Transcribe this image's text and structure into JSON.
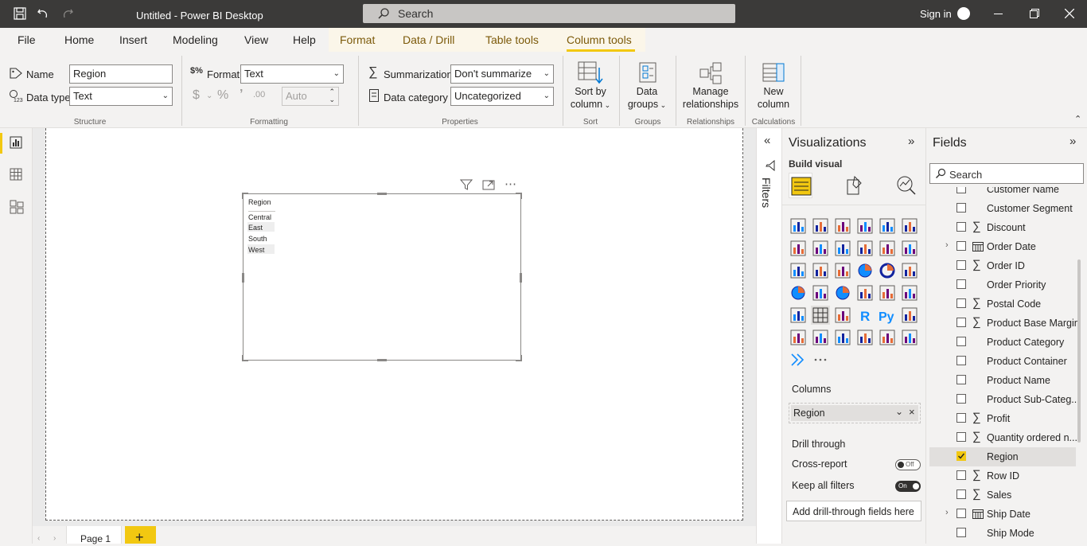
{
  "titlebar": {
    "title": "Untitled - Power BI Desktop",
    "search_placeholder": "Search",
    "sign_in": "Sign in"
  },
  "menu": {
    "items": [
      "File",
      "Home",
      "Insert",
      "Modeling",
      "View",
      "Help",
      "Format",
      "Data / Drill",
      "Table tools",
      "Column tools"
    ]
  },
  "ribbon": {
    "structure": {
      "name_label": "Name",
      "name_value": "Region",
      "datatype_label": "Data type",
      "datatype_value": "Text",
      "group": "Structure"
    },
    "formatting": {
      "format_label": "Format",
      "format_value": "Text",
      "auto_value": "Auto",
      "group": "Formatting"
    },
    "properties": {
      "summarization_label": "Summarization",
      "summarization_value": "Don't summarize",
      "category_label": "Data category",
      "category_value": "Uncategorized",
      "group": "Properties"
    },
    "sort": {
      "line1": "Sort by",
      "line2": "column",
      "group": "Sort"
    },
    "groups": {
      "line1": "Data",
      "line2": "groups",
      "group": "Groups"
    },
    "relationships": {
      "line1": "Manage",
      "line2": "relationships",
      "group": "Relationships"
    },
    "calculations": {
      "line1": "New",
      "line2": "column",
      "group": "Calculations"
    }
  },
  "visual": {
    "header": "Region",
    "rows": [
      "Central",
      "East",
      "South",
      "West"
    ]
  },
  "filters": {
    "label": "Filters"
  },
  "visualizations": {
    "title": "Visualizations",
    "build_visual": "Build visual",
    "columns_label": "Columns",
    "columns_field": "Region",
    "drill_through": "Drill through",
    "cross_report": "Cross-report",
    "cross_report_state": "Off",
    "keep_filters": "Keep all filters",
    "keep_filters_state": "On",
    "add_drill": "Add drill-through fields here"
  },
  "fields": {
    "title": "Fields",
    "search_placeholder": "Search",
    "items": [
      {
        "label": "Customer Name",
        "sigma": false,
        "expand": false,
        "checked": false
      },
      {
        "label": "Customer Segment",
        "sigma": false,
        "expand": false,
        "checked": false
      },
      {
        "label": "Discount",
        "sigma": true,
        "expand": false,
        "checked": false
      },
      {
        "label": "Order Date",
        "sigma": false,
        "expand": true,
        "checked": false,
        "calendar": true
      },
      {
        "label": "Order ID",
        "sigma": true,
        "expand": false,
        "checked": false
      },
      {
        "label": "Order Priority",
        "sigma": false,
        "expand": false,
        "checked": false
      },
      {
        "label": "Postal Code",
        "sigma": true,
        "expand": false,
        "checked": false
      },
      {
        "label": "Product Base Margin",
        "sigma": true,
        "expand": false,
        "checked": false
      },
      {
        "label": "Product Category",
        "sigma": false,
        "expand": false,
        "checked": false
      },
      {
        "label": "Product Container",
        "sigma": false,
        "expand": false,
        "checked": false
      },
      {
        "label": "Product Name",
        "sigma": false,
        "expand": false,
        "checked": false
      },
      {
        "label": "Product Sub-Categ...",
        "sigma": false,
        "expand": false,
        "checked": false
      },
      {
        "label": "Profit",
        "sigma": true,
        "expand": false,
        "checked": false
      },
      {
        "label": "Quantity ordered n...",
        "sigma": true,
        "expand": false,
        "checked": false
      },
      {
        "label": "Region",
        "sigma": false,
        "expand": false,
        "checked": true
      },
      {
        "label": "Row ID",
        "sigma": true,
        "expand": false,
        "checked": false
      },
      {
        "label": "Sales",
        "sigma": true,
        "expand": false,
        "checked": false
      },
      {
        "label": "Ship Date",
        "sigma": false,
        "expand": true,
        "checked": false,
        "calendar": true
      },
      {
        "label": "Ship Mode",
        "sigma": false,
        "expand": false,
        "checked": false
      }
    ]
  },
  "pages": {
    "page1": "Page 1",
    "add": "+"
  },
  "colors": {
    "accent": "#f2c811",
    "titlebar": "#3b3a39",
    "context_tab": "#7c5a0a"
  }
}
